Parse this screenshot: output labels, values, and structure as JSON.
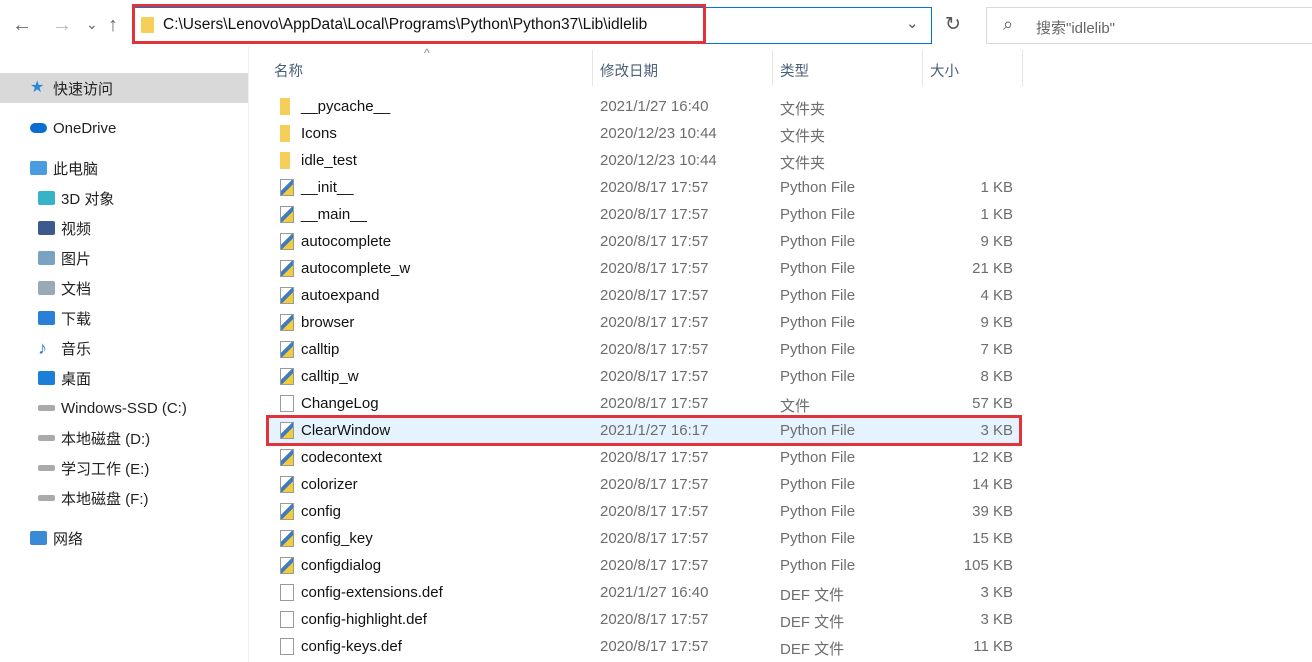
{
  "toolbar": {
    "back": "←",
    "forward": "→",
    "recent": "⌄",
    "up": "↑",
    "path": "C:\\Users\\Lenovo\\AppData\\Local\\Programs\\Python\\Python37\\Lib\\idlelib",
    "dropdown": "⌄",
    "refresh": "↻",
    "search_placeholder": "搜索\"idlelib\"",
    "search_icon": "⌕"
  },
  "sidebar": {
    "items": [
      {
        "label": "快速访问",
        "icon": "star-icon",
        "color": "#2b88d8"
      },
      {
        "label": "OneDrive",
        "icon": "cloud-icon",
        "color": "#0a6ed1"
      },
      {
        "label": "此电脑",
        "icon": "computer-icon",
        "color": "#4a9be0"
      },
      {
        "label": "3D 对象",
        "icon": "cube-icon",
        "color": "#37b3c7"
      },
      {
        "label": "视频",
        "icon": "film-icon",
        "color": "#3d5a8c"
      },
      {
        "label": "图片",
        "icon": "picture-icon",
        "color": "#7aa3c3"
      },
      {
        "label": "文档",
        "icon": "document-icon",
        "color": "#9aa9b8"
      },
      {
        "label": "下载",
        "icon": "download-icon",
        "color": "#2c7fd6"
      },
      {
        "label": "音乐",
        "icon": "music-icon",
        "color": "#2c7fd6"
      },
      {
        "label": "桌面",
        "icon": "desktop-icon",
        "color": "#1a7fd6"
      },
      {
        "label": "Windows-SSD (C:)",
        "icon": "drive-icon",
        "color": "#999"
      },
      {
        "label": "本地磁盘 (D:)",
        "icon": "drive-icon",
        "color": "#999"
      },
      {
        "label": "学习工作 (E:)",
        "icon": "drive-icon",
        "color": "#999"
      },
      {
        "label": "本地磁盘 (F:)",
        "icon": "drive-icon",
        "color": "#999"
      },
      {
        "label": "网络",
        "icon": "network-icon",
        "color": "#3a8ad6"
      }
    ]
  },
  "columns": {
    "name": "名称",
    "date": "修改日期",
    "type": "类型",
    "size": "大小",
    "sort_indicator": "^"
  },
  "files": [
    {
      "name": "__pycache__",
      "date": "2021/1/27 16:40",
      "type": "文件夹",
      "size": "",
      "icon": "folder"
    },
    {
      "name": "Icons",
      "date": "2020/12/23 10:44",
      "type": "文件夹",
      "size": "",
      "icon": "folder"
    },
    {
      "name": "idle_test",
      "date": "2020/12/23 10:44",
      "type": "文件夹",
      "size": "",
      "icon": "folder"
    },
    {
      "name": "__init__",
      "date": "2020/8/17 17:57",
      "type": "Python File",
      "size": "1 KB",
      "icon": "python"
    },
    {
      "name": "__main__",
      "date": "2020/8/17 17:57",
      "type": "Python File",
      "size": "1 KB",
      "icon": "python"
    },
    {
      "name": "autocomplete",
      "date": "2020/8/17 17:57",
      "type": "Python File",
      "size": "9 KB",
      "icon": "python"
    },
    {
      "name": "autocomplete_w",
      "date": "2020/8/17 17:57",
      "type": "Python File",
      "size": "21 KB",
      "icon": "python"
    },
    {
      "name": "autoexpand",
      "date": "2020/8/17 17:57",
      "type": "Python File",
      "size": "4 KB",
      "icon": "python"
    },
    {
      "name": "browser",
      "date": "2020/8/17 17:57",
      "type": "Python File",
      "size": "9 KB",
      "icon": "python"
    },
    {
      "name": "calltip",
      "date": "2020/8/17 17:57",
      "type": "Python File",
      "size": "7 KB",
      "icon": "python"
    },
    {
      "name": "calltip_w",
      "date": "2020/8/17 17:57",
      "type": "Python File",
      "size": "8 KB",
      "icon": "python"
    },
    {
      "name": "ChangeLog",
      "date": "2020/8/17 17:57",
      "type": "文件",
      "size": "57 KB",
      "icon": "file"
    },
    {
      "name": "ClearWindow",
      "date": "2021/1/27 16:17",
      "type": "Python File",
      "size": "3 KB",
      "icon": "python",
      "selected": true
    },
    {
      "name": "codecontext",
      "date": "2020/8/17 17:57",
      "type": "Python File",
      "size": "12 KB",
      "icon": "python"
    },
    {
      "name": "colorizer",
      "date": "2020/8/17 17:57",
      "type": "Python File",
      "size": "14 KB",
      "icon": "python"
    },
    {
      "name": "config",
      "date": "2020/8/17 17:57",
      "type": "Python File",
      "size": "39 KB",
      "icon": "python"
    },
    {
      "name": "config_key",
      "date": "2020/8/17 17:57",
      "type": "Python File",
      "size": "15 KB",
      "icon": "python"
    },
    {
      "name": "configdialog",
      "date": "2020/8/17 17:57",
      "type": "Python File",
      "size": "105 KB",
      "icon": "python"
    },
    {
      "name": "config-extensions.def",
      "date": "2021/1/27 16:40",
      "type": "DEF 文件",
      "size": "3 KB",
      "icon": "file"
    },
    {
      "name": "config-highlight.def",
      "date": "2020/8/17 17:57",
      "type": "DEF 文件",
      "size": "3 KB",
      "icon": "file"
    },
    {
      "name": "config-keys.def",
      "date": "2020/8/17 17:57",
      "type": "DEF 文件",
      "size": "11 KB",
      "icon": "file"
    }
  ],
  "colors": {
    "highlight": "#e0333a",
    "selection": "#e5f3ff",
    "quick_access_bg": "#d9d9d9"
  }
}
